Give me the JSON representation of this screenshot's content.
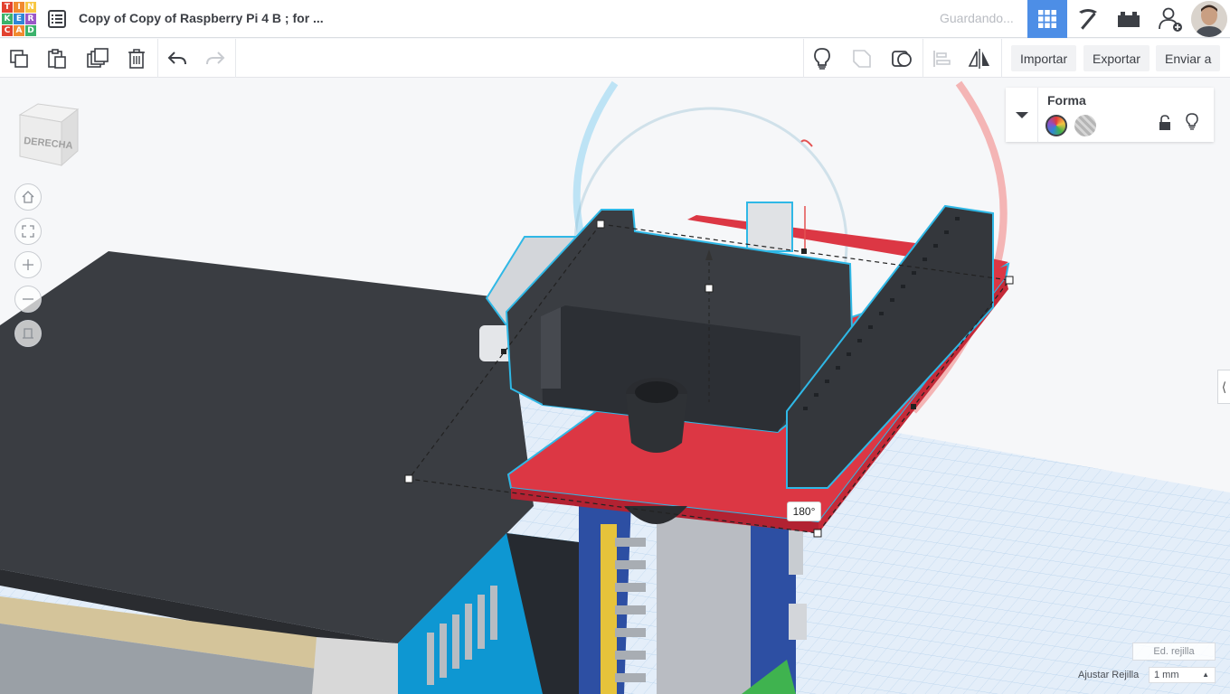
{
  "header": {
    "logo_letters": [
      "T",
      "I",
      "N",
      "K",
      "E",
      "R",
      "C",
      "A",
      "D"
    ],
    "logo_colors": [
      "#e2412f",
      "#f18a2f",
      "#f7c744",
      "#3bb26b",
      "#2f86d6",
      "#9a57c7",
      "#e2412f",
      "#f18a2f",
      "#3bb26b"
    ],
    "doc_title": "Copy of Copy of Raspberry Pi 4 B ; for ...",
    "status": "Guardando...",
    "buttons": [
      "grid-view",
      "pickaxe",
      "bricks",
      "add-user"
    ]
  },
  "toolbar": {
    "import_label": "Importar",
    "export_label": "Exportar",
    "send_label": "Enviar a"
  },
  "viewcube": {
    "face_label": "DERECHA"
  },
  "shape_panel": {
    "title": "Forma",
    "solid_color": "rainbow",
    "hole_color": "#b5b5b5"
  },
  "rotation": {
    "angle_label": "180°"
  },
  "grid": {
    "edit_label": "Ed. rejilla",
    "snap_label": "Ajustar Rejilla",
    "snap_value": "1 mm"
  },
  "colors": {
    "accent": "#4d8ee6",
    "board_red": "#dc3744",
    "selection_outline": "#2fb8e6",
    "dark_part": "#3a3d42"
  }
}
